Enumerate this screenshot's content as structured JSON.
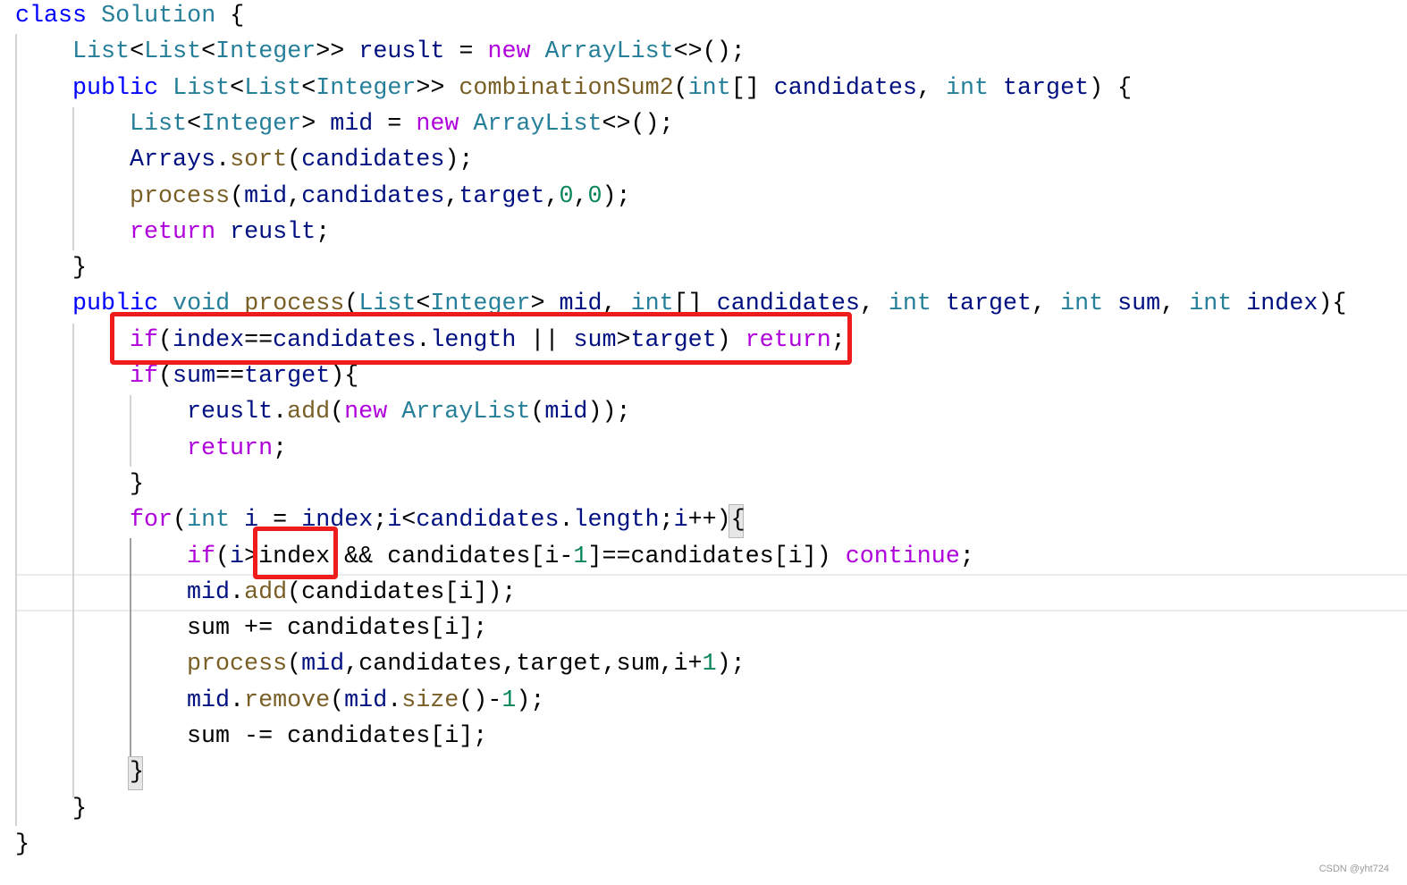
{
  "editor": {
    "lines": [
      {
        "indent": 0,
        "tokens": [
          [
            "class",
            "k"
          ],
          [
            " ",
            "p"
          ],
          [
            "Solution",
            "t"
          ],
          [
            " {",
            "p"
          ]
        ]
      },
      {
        "indent": 1,
        "tokens": [
          [
            "List",
            "t"
          ],
          [
            "<",
            "p"
          ],
          [
            "List",
            "t"
          ],
          [
            "<",
            "p"
          ],
          [
            "Integer",
            "t"
          ],
          [
            ">> ",
            "p"
          ],
          [
            "reuslt",
            "v"
          ],
          [
            " = ",
            "p"
          ],
          [
            "new",
            "c"
          ],
          [
            " ",
            "p"
          ],
          [
            "ArrayList",
            "t"
          ],
          [
            "<>();",
            "p"
          ]
        ]
      },
      {
        "indent": 1,
        "tokens": [
          [
            "public",
            "k"
          ],
          [
            " ",
            "p"
          ],
          [
            "List",
            "t"
          ],
          [
            "<",
            "p"
          ],
          [
            "List",
            "t"
          ],
          [
            "<",
            "p"
          ],
          [
            "Integer",
            "t"
          ],
          [
            ">> ",
            "p"
          ],
          [
            "combinationSum2",
            "f"
          ],
          [
            "(",
            "p"
          ],
          [
            "int",
            "t"
          ],
          [
            "[] ",
            "p"
          ],
          [
            "candidates",
            "v"
          ],
          [
            ", ",
            "p"
          ],
          [
            "int",
            "t"
          ],
          [
            " ",
            "p"
          ],
          [
            "target",
            "v"
          ],
          [
            ") {",
            "p"
          ]
        ]
      },
      {
        "indent": 2,
        "tokens": [
          [
            "List",
            "t"
          ],
          [
            "<",
            "p"
          ],
          [
            "Integer",
            "t"
          ],
          [
            "> ",
            "p"
          ],
          [
            "mid",
            "v"
          ],
          [
            " = ",
            "p"
          ],
          [
            "new",
            "c"
          ],
          [
            " ",
            "p"
          ],
          [
            "ArrayList",
            "t"
          ],
          [
            "<>();",
            "p"
          ]
        ]
      },
      {
        "indent": 2,
        "tokens": [
          [
            "Arrays",
            "v"
          ],
          [
            ".",
            "p"
          ],
          [
            "sort",
            "f"
          ],
          [
            "(",
            "p"
          ],
          [
            "candidates",
            "v"
          ],
          [
            ");",
            "p"
          ]
        ]
      },
      {
        "indent": 2,
        "tokens": [
          [
            "process",
            "f"
          ],
          [
            "(",
            "p"
          ],
          [
            "mid",
            "v"
          ],
          [
            ",",
            "p"
          ],
          [
            "candidates",
            "v"
          ],
          [
            ",",
            "p"
          ],
          [
            "target",
            "v"
          ],
          [
            ",",
            "p"
          ],
          [
            "0",
            "n"
          ],
          [
            ",",
            "p"
          ],
          [
            "0",
            "n"
          ],
          [
            ");",
            "p"
          ]
        ]
      },
      {
        "indent": 2,
        "tokens": [
          [
            "return",
            "c"
          ],
          [
            " ",
            "p"
          ],
          [
            "reuslt",
            "v"
          ],
          [
            ";",
            "p"
          ]
        ]
      },
      {
        "indent": 1,
        "tokens": [
          [
            "}",
            "p"
          ]
        ]
      },
      {
        "indent": 1,
        "tokens": [
          [
            "public",
            "k"
          ],
          [
            " ",
            "p"
          ],
          [
            "void",
            "t"
          ],
          [
            " ",
            "p"
          ],
          [
            "process",
            "f"
          ],
          [
            "(",
            "p"
          ],
          [
            "List",
            "t"
          ],
          [
            "<",
            "p"
          ],
          [
            "Integer",
            "t"
          ],
          [
            "> ",
            "p"
          ],
          [
            "mid",
            "v"
          ],
          [
            ", ",
            "p"
          ],
          [
            "int",
            "t"
          ],
          [
            "[] ",
            "p"
          ],
          [
            "candidates",
            "v"
          ],
          [
            ", ",
            "p"
          ],
          [
            "int",
            "t"
          ],
          [
            " ",
            "p"
          ],
          [
            "target",
            "v"
          ],
          [
            ", ",
            "p"
          ],
          [
            "int",
            "t"
          ],
          [
            " ",
            "p"
          ],
          [
            "sum",
            "v"
          ],
          [
            ", ",
            "p"
          ],
          [
            "int",
            "t"
          ],
          [
            " ",
            "p"
          ],
          [
            "index",
            "v"
          ],
          [
            "){",
            "p"
          ]
        ]
      },
      {
        "indent": 2,
        "tokens": [
          [
            "if",
            "c"
          ],
          [
            "(",
            "p"
          ],
          [
            "index",
            "v"
          ],
          [
            "==",
            "p"
          ],
          [
            "candidates",
            "v"
          ],
          [
            ".",
            "p"
          ],
          [
            "length",
            "v"
          ],
          [
            " || ",
            "p"
          ],
          [
            "sum",
            "v"
          ],
          [
            ">",
            "p"
          ],
          [
            "target",
            "v"
          ],
          [
            ") ",
            "p"
          ],
          [
            "return",
            "c"
          ],
          [
            ";",
            "p"
          ]
        ]
      },
      {
        "indent": 2,
        "tokens": [
          [
            "if",
            "c"
          ],
          [
            "(",
            "p"
          ],
          [
            "sum",
            "v"
          ],
          [
            "==",
            "p"
          ],
          [
            "target",
            "v"
          ],
          [
            "){",
            "p"
          ]
        ]
      },
      {
        "indent": 3,
        "tokens": [
          [
            "reuslt",
            "v"
          ],
          [
            ".",
            "p"
          ],
          [
            "add",
            "f"
          ],
          [
            "(",
            "p"
          ],
          [
            "new",
            "c"
          ],
          [
            " ",
            "p"
          ],
          [
            "ArrayList",
            "t"
          ],
          [
            "(",
            "p"
          ],
          [
            "mid",
            "v"
          ],
          [
            "));",
            "p"
          ]
        ]
      },
      {
        "indent": 3,
        "tokens": [
          [
            "return",
            "c"
          ],
          [
            ";",
            "p"
          ]
        ]
      },
      {
        "indent": 2,
        "tokens": [
          [
            "}",
            "p"
          ]
        ]
      },
      {
        "indent": 2,
        "tokens": [
          [
            "for",
            "c"
          ],
          [
            "(",
            "p"
          ],
          [
            "int",
            "t"
          ],
          [
            " ",
            "p"
          ],
          [
            "i",
            "v"
          ],
          [
            " = ",
            "p"
          ],
          [
            "index",
            "v"
          ],
          [
            ";",
            "p"
          ],
          [
            "i",
            "v"
          ],
          [
            "<",
            "p"
          ],
          [
            "candidates",
            "v"
          ],
          [
            ".",
            "p"
          ],
          [
            "length",
            "v"
          ],
          [
            ";",
            "p"
          ],
          [
            "i",
            "v"
          ],
          [
            "++){",
            "p"
          ]
        ]
      },
      {
        "indent": 3,
        "tokens": [
          [
            "if",
            "c"
          ],
          [
            "(",
            "p"
          ],
          [
            "i",
            "v"
          ],
          [
            ">",
            "p"
          ],
          [
            "index",
            "p"
          ],
          [
            " && ",
            "p"
          ],
          [
            "candidates",
            "p"
          ],
          [
            "[",
            "p"
          ],
          [
            "i",
            "p"
          ],
          [
            "-",
            "p"
          ],
          [
            "1",
            "n"
          ],
          [
            "]==",
            "p"
          ],
          [
            "candidates",
            "p"
          ],
          [
            "[",
            "p"
          ],
          [
            "i",
            "p"
          ],
          [
            "]) ",
            "p"
          ],
          [
            "continue",
            "c"
          ],
          [
            ";",
            "p"
          ]
        ]
      },
      {
        "indent": 3,
        "tokens": [
          [
            "mid",
            "v"
          ],
          [
            ".",
            "p"
          ],
          [
            "add",
            "f"
          ],
          [
            "(",
            "p"
          ],
          [
            "candidates",
            "p"
          ],
          [
            "[",
            "p"
          ],
          [
            "i",
            "p"
          ],
          [
            "]);",
            "p"
          ]
        ]
      },
      {
        "indent": 3,
        "tokens": [
          [
            "sum",
            "p"
          ],
          [
            " += ",
            "p"
          ],
          [
            "candidates",
            "p"
          ],
          [
            "[",
            "p"
          ],
          [
            "i",
            "p"
          ],
          [
            "];",
            "p"
          ]
        ]
      },
      {
        "indent": 3,
        "tokens": [
          [
            "process",
            "f"
          ],
          [
            "(",
            "p"
          ],
          [
            "mid",
            "v"
          ],
          [
            ",",
            "p"
          ],
          [
            "candidates",
            "p"
          ],
          [
            ",",
            "p"
          ],
          [
            "target",
            "p"
          ],
          [
            ",",
            "p"
          ],
          [
            "sum",
            "p"
          ],
          [
            ",",
            "p"
          ],
          [
            "i",
            "p"
          ],
          [
            "+",
            "p"
          ],
          [
            "1",
            "n"
          ],
          [
            ");",
            "p"
          ]
        ]
      },
      {
        "indent": 3,
        "tokens": [
          [
            "mid",
            "v"
          ],
          [
            ".",
            "p"
          ],
          [
            "remove",
            "f"
          ],
          [
            "(",
            "p"
          ],
          [
            "mid",
            "v"
          ],
          [
            ".",
            "p"
          ],
          [
            "size",
            "f"
          ],
          [
            "()-",
            "p"
          ],
          [
            "1",
            "n"
          ],
          [
            ");",
            "p"
          ]
        ]
      },
      {
        "indent": 3,
        "tokens": [
          [
            "sum",
            "p"
          ],
          [
            " -= ",
            "p"
          ],
          [
            "candidates",
            "p"
          ],
          [
            "[",
            "p"
          ],
          [
            "i",
            "p"
          ],
          [
            "];",
            "p"
          ]
        ]
      },
      {
        "indent": 2,
        "tokens": [
          [
            "}",
            "p"
          ]
        ]
      },
      {
        "indent": 1,
        "tokens": [
          [
            "}",
            "p"
          ]
        ]
      },
      {
        "indent": 0,
        "tokens": [
          [
            "}",
            "p"
          ]
        ]
      }
    ],
    "colors": {
      "keyword": "#0000ff",
      "type": "#267f99",
      "variable": "#001080",
      "control": "#af00db",
      "function": "#795e26",
      "number": "#098658",
      "annotation_box": "#ee1c1c"
    }
  },
  "watermark": "CSDN @yht724"
}
